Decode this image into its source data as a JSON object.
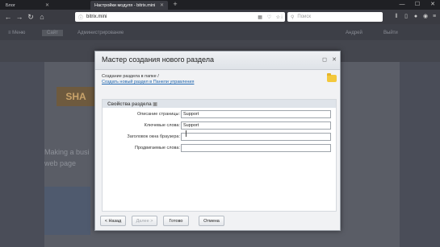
{
  "browser": {
    "tabs": [
      {
        "label": "Блог",
        "active": false
      },
      {
        "label": "Настройки модуля - bitrix.mini",
        "active": true
      }
    ],
    "url": "bitrix.mini",
    "search_placeholder": "Поиск"
  },
  "admin_panel": {
    "menu": "Меню",
    "site_tab": "Сайт",
    "admin_tab": "Администрирование",
    "user": "Андрей",
    "exit": "Выйти"
  },
  "page": {
    "heading_line1": "Making a busi",
    "heading_line2": "web page"
  },
  "dialog": {
    "title": "Мастер создания нового раздела",
    "folder_line": "Создание раздела в папке /",
    "panel_link": "Создать новый раздел в Панели управления",
    "section_title": "Свойства раздела",
    "fields": [
      {
        "label": "Описание страницы:",
        "value": "Support"
      },
      {
        "label": "Ключевые слова:",
        "value": "Support"
      },
      {
        "label": "Заголовок окна браузера:",
        "value": ""
      },
      {
        "label": "Продвигаемые слова:",
        "value": ""
      }
    ],
    "buttons": {
      "back": "< Назад",
      "next": "Далее >",
      "done": "Готово",
      "cancel": "Отмена"
    }
  }
}
